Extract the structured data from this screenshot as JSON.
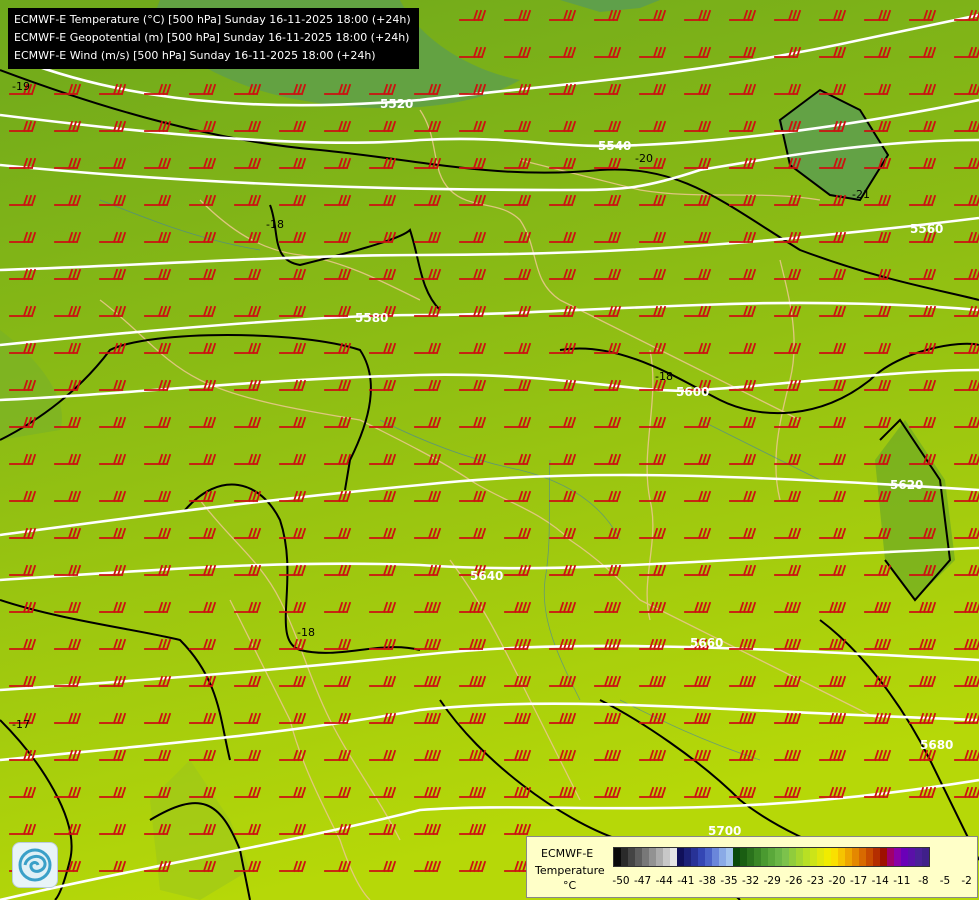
{
  "header": {
    "lines": [
      "ECMWF-E Temperature (°C) [500 hPa] Sunday 16-11-2025 18:00 (+24h)",
      "ECMWF-E Geopotential (m) [500 hPa] Sunday 16-11-2025 18:00 (+24h)",
      "ECMWF-E Wind (m/s) [500 hPa] Sunday 16-11-2025 18:00 (+24h)"
    ]
  },
  "map": {
    "geopotential_labels": [
      "5520",
      "5540",
      "5560",
      "5580",
      "5600",
      "5620",
      "5640",
      "5660",
      "5680",
      "5700"
    ],
    "temperature_labels": [
      "-19",
      "-20",
      "-21",
      "-18",
      "-18",
      "-17",
      "-18"
    ],
    "colors": {
      "isohypse": "#ffffff",
      "isotherm": "#000000",
      "wind_barb": "#cc1111",
      "borders": "#e8c88a",
      "rivers": "#3a7ab8"
    }
  },
  "legend": {
    "model": "ECMWF-E",
    "variable": "Temperature",
    "unit": "°C",
    "tick_labels": [
      "-50",
      "-47",
      "-44",
      "-41",
      "-38",
      "-35",
      "-32",
      "-29",
      "-26",
      "-23",
      "-20",
      "-17",
      "-14",
      "-11",
      "-8",
      "-5",
      "-2"
    ],
    "colors": [
      "#0a0a0a",
      "#2a2a2a",
      "#444444",
      "#5e5e5e",
      "#787878",
      "#929292",
      "#acacac",
      "#c8c8c8",
      "#e6e6e6",
      "#10105a",
      "#1c2178",
      "#283296",
      "#3446b4",
      "#4a62c8",
      "#6a86da",
      "#8aaae6",
      "#a4c4ee",
      "#0a4a0a",
      "#1a5e12",
      "#2a721c",
      "#3a8626",
      "#4a9a30",
      "#5aa83a",
      "#6ab646",
      "#7cc24c",
      "#90cc3c",
      "#a4d630",
      "#b8e024",
      "#cce418",
      "#e0e80c",
      "#f0ec00",
      "#fae000",
      "#f6c400",
      "#eea600",
      "#e48800",
      "#d86a00",
      "#c84c00",
      "#b42e00",
      "#9e1000",
      "#a0006a",
      "#8a00a8",
      "#6a00b8",
      "#5a10a8",
      "#4a2098",
      "#40208a"
    ]
  }
}
